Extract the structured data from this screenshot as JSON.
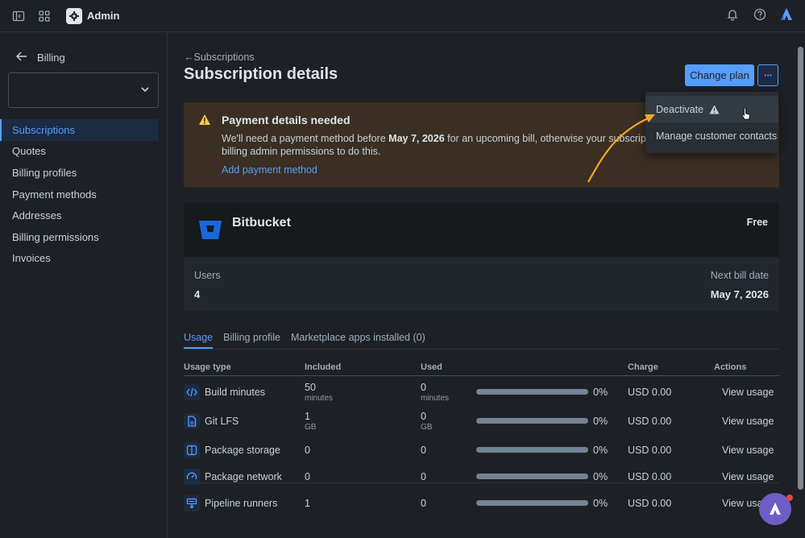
{
  "topbar": {
    "app_name": "Admin"
  },
  "sidebar": {
    "back_label": "Billing",
    "selector_value": "",
    "items": [
      {
        "label": "Subscriptions",
        "active": true
      },
      {
        "label": "Quotes"
      },
      {
        "label": "Billing profiles"
      },
      {
        "label": "Payment methods"
      },
      {
        "label": "Addresses"
      },
      {
        "label": "Billing permissions"
      },
      {
        "label": "Invoices"
      }
    ]
  },
  "main": {
    "breadcrumb": "←Subscriptions",
    "title": "Subscription details",
    "change_plan_label": "Change plan",
    "more_label": "···"
  },
  "banner": {
    "title": "Payment details needed",
    "text_before": "We'll need a payment method before ",
    "date": "May 7, 2026",
    "text_after": " for an upcoming bill, otherwise your subscription w",
    "text_line2": "billing admin permissions to do this.",
    "link": "Add payment method"
  },
  "product": {
    "name": "Bitbucket",
    "plan": "Free",
    "users_label": "Users",
    "users_value": "4",
    "next_bill_label": "Next bill date",
    "next_bill_value": "May 7, 2026"
  },
  "tabs": [
    "Usage",
    "Billing profile",
    "Marketplace apps installed (0)"
  ],
  "table": {
    "headers": [
      "Usage type",
      "Included",
      "Used",
      "Charge",
      "Actions"
    ],
    "rows": [
      {
        "icon": "code-icon",
        "name": "Build minutes",
        "included": "50",
        "included_unit": "minutes",
        "used": "0",
        "used_unit": "minutes",
        "progress": 0,
        "pct": "0%",
        "charge": "USD 0.00",
        "action": "View usage"
      },
      {
        "icon": "file-icon",
        "name": "Git LFS",
        "included": "1",
        "included_unit": "GB",
        "used": "0",
        "used_unit": "GB",
        "progress": 0,
        "pct": "0%",
        "charge": "USD 0.00",
        "action": "View usage"
      },
      {
        "icon": "package-icon",
        "name": "Package storage",
        "included": "0",
        "included_unit": "",
        "used": "0",
        "used_unit": "",
        "progress": 0,
        "pct": "0%",
        "charge": "USD 0.00",
        "action": "View usage"
      },
      {
        "icon": "gauge-icon",
        "name": "Package network",
        "included": "0",
        "included_unit": "",
        "used": "0",
        "used_unit": "",
        "progress": 0,
        "pct": "0%",
        "charge": "USD 0.00",
        "action": "View usage"
      },
      {
        "icon": "runner-icon",
        "name": "Pipeline runners",
        "included": "1",
        "included_unit": "",
        "used": "0",
        "used_unit": "",
        "progress": 0,
        "pct": "0%",
        "charge": "USD 0.00",
        "action": "View usa"
      }
    ]
  },
  "menu": {
    "items": [
      "Deactivate",
      "Manage customer contacts"
    ]
  },
  "colors": {
    "accent": "#579dff",
    "warning": "#f5cd47",
    "annotation_arrow": "#f5a623"
  }
}
